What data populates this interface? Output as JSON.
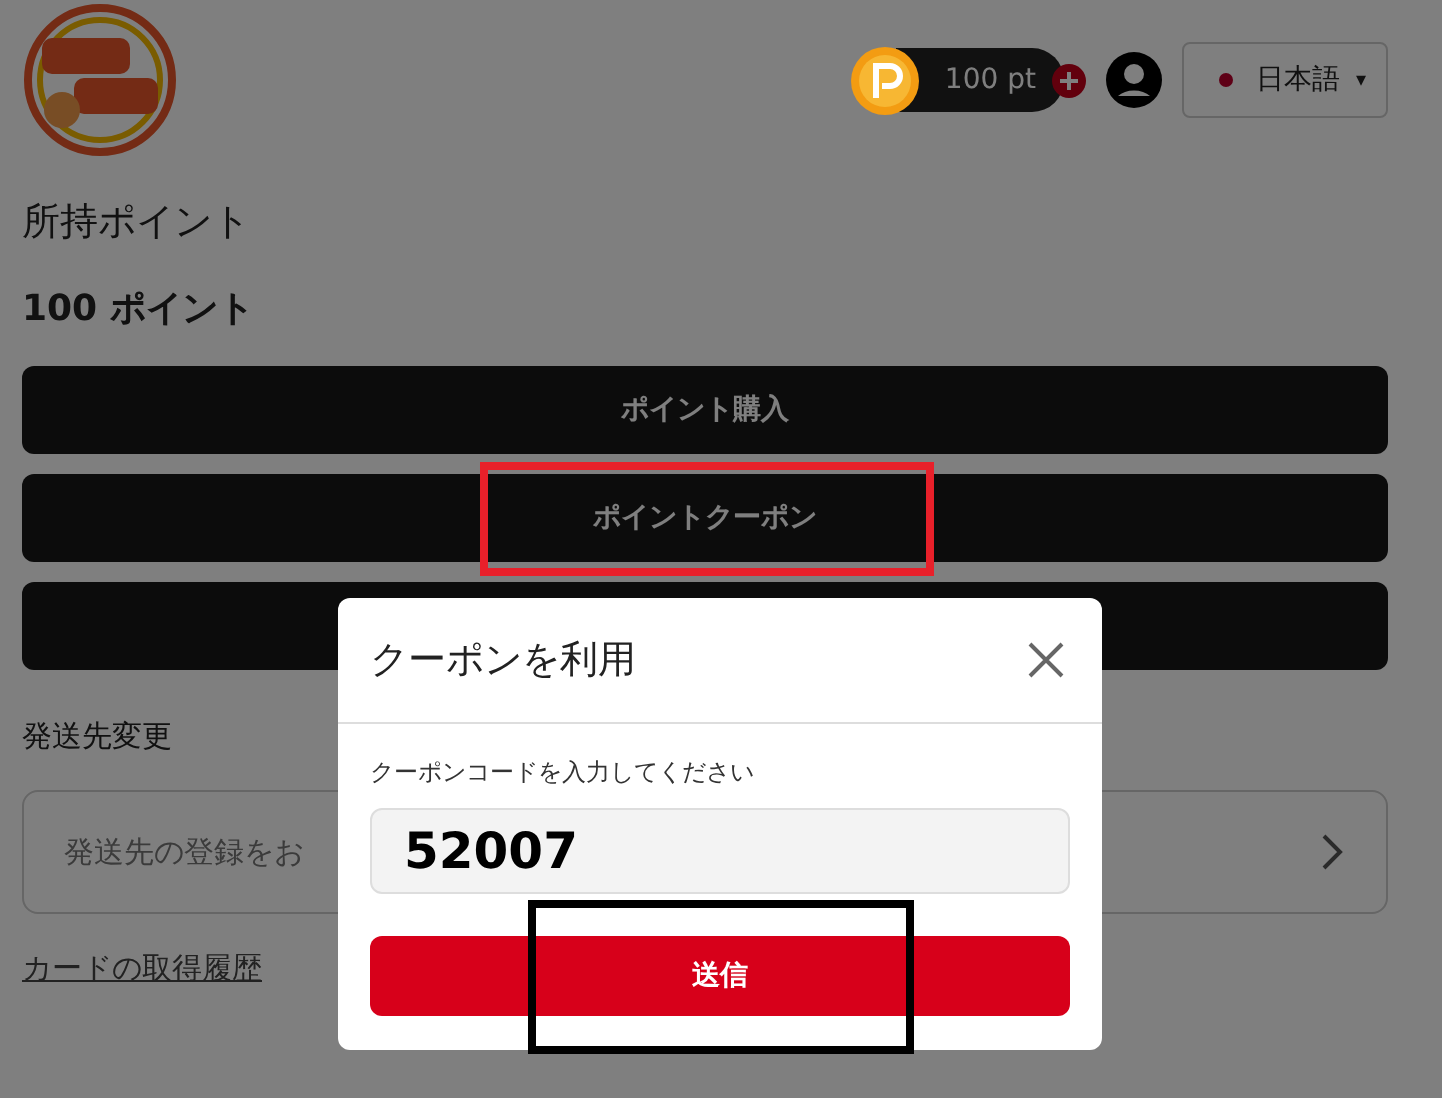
{
  "header": {
    "points": "100 pt",
    "language": {
      "label": "日本語",
      "caret": "▾"
    }
  },
  "owned_points": {
    "title": "所持ポイント",
    "value": "100 ポイント"
  },
  "actions": [
    {
      "label": "ポイント購入"
    },
    {
      "label": "ポイントクーポン"
    }
  ],
  "shipping": {
    "title": "発送先変更",
    "placeholder": "発送先の登録をお"
  },
  "history_link": "カードの取得履歴",
  "dialog": {
    "title": "クーポンを利用",
    "field_label": "クーポンコードを入力してください",
    "code": "52007",
    "submit": "送信"
  },
  "annotations": [
    {
      "color": "#e8202a"
    },
    {
      "color": "#000000"
    }
  ]
}
